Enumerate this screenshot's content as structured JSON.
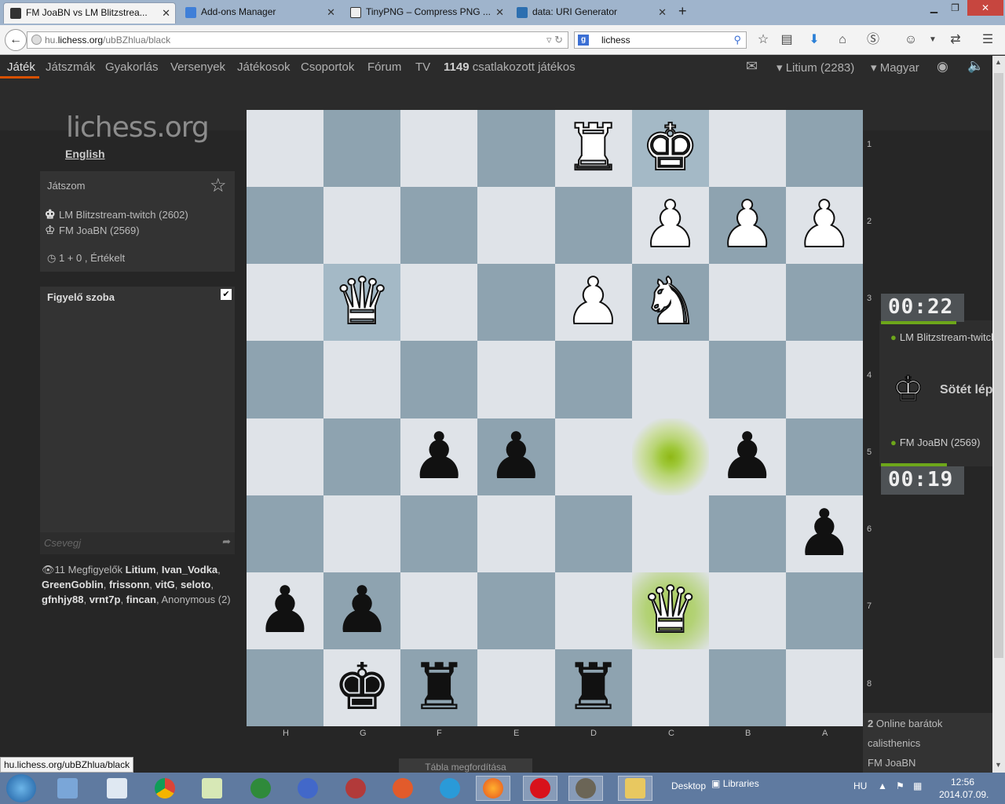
{
  "browser": {
    "tabs": [
      {
        "label": "FM JoaBN vs LM Blitzstrea...",
        "color": "#3a3a3a"
      },
      {
        "label": "Add-ons Manager",
        "color": "#3f7fd8"
      },
      {
        "label": "TinyPNG – Compress PNG ...",
        "color": "#2b2b2b"
      },
      {
        "label": "data: URI Generator",
        "color": "#2c6fb0"
      }
    ],
    "url_prefix": "hu.",
    "url_domain": "lichess.org",
    "url_path": "/ubBZhlua/black",
    "search_value": "lichess",
    "status_url": "hu.lichess.org/ubBZhlua/black"
  },
  "nav": {
    "items": [
      "Játék",
      "Játszmák",
      "Gyakorlás",
      "Versenyek",
      "Játékosok",
      "Csoportok",
      "Fórum",
      "TV"
    ],
    "online_count": "1149",
    "online_text": "csatlakozott játékos",
    "user": "Litium (2283)",
    "language": "Magyar"
  },
  "logo": {
    "main": "lichess",
    "suffix": ".org"
  },
  "lang_link": "English",
  "game_panel": {
    "title": "Játszom",
    "black_player": "LM Blitzstream-twitch (2602)",
    "white_player": "FM JoaBN (2569)",
    "time_control": "1 + 0 , Értékelt"
  },
  "chat": {
    "title": "Figyelő szoba",
    "placeholder": "Csevegj"
  },
  "watchers": {
    "prefix": "11 Megfigyelők",
    "names": [
      "Litium",
      "Ivan_Vodka",
      "GreenGoblin",
      "frissonn",
      "vitG",
      "seloto",
      "gfnhjy88",
      "vrnt7p",
      "fincan"
    ],
    "anonymous": "Anonymous (2)"
  },
  "board": {
    "ranks": [
      "1",
      "2",
      "3",
      "4",
      "5",
      "6",
      "7",
      "8"
    ],
    "files": [
      "H",
      "G",
      "F",
      "E",
      "D",
      "C",
      "B",
      "A"
    ],
    "rows": [
      [
        "",
        "",
        "",
        "",
        "wR",
        "wK",
        "",
        ""
      ],
      [
        "",
        "",
        "",
        "",
        "",
        "wP",
        "wP",
        "wP"
      ],
      [
        "",
        "wQ",
        "",
        "",
        "wP",
        "wN",
        "",
        ""
      ],
      [
        "",
        "",
        "",
        "",
        "",
        "",
        "",
        ""
      ],
      [
        "",
        "",
        "bP",
        "bP",
        "",
        "",
        "bP",
        ""
      ],
      [
        "",
        "",
        "",
        "",
        "",
        "",
        "",
        "bP"
      ],
      [
        "bP",
        "bP",
        "",
        "",
        "",
        "wQ",
        "",
        ""
      ],
      [
        "",
        "bK",
        "bR",
        "",
        "bR",
        "",
        "",
        ""
      ]
    ]
  },
  "clocks": {
    "top": "00:22",
    "top_player": "LM Blitzstream-twitch",
    "turn_text": "Sötét lép",
    "bottom_player": "FM JoaBN (2569)",
    "bottom": "00:19"
  },
  "friends": {
    "count": "2",
    "label": "Online barátok",
    "list": [
      "calisthenics",
      "FM JoaBN"
    ]
  },
  "flip_label": "Tábla megfordítása",
  "taskbar": {
    "desktop": "Desktop",
    "libraries": "Libraries",
    "lang": "HU",
    "time": "12:56",
    "date": "2014.07.09."
  }
}
